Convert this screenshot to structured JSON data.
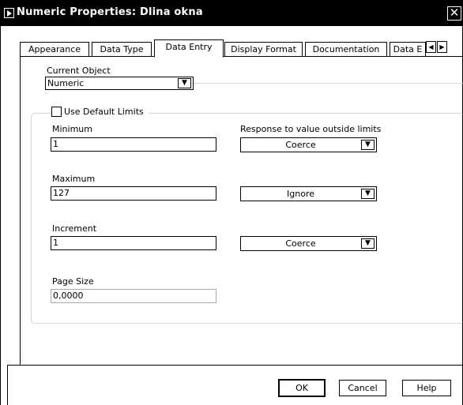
{
  "window": {
    "title": "Numeric Properties: Dlina okna"
  },
  "tabs": [
    {
      "label": "Appearance"
    },
    {
      "label": "Data Type"
    },
    {
      "label": "Data Entry",
      "active": true
    },
    {
      "label": "Display Format"
    },
    {
      "label": "Documentation"
    },
    {
      "label": "Data E"
    }
  ],
  "current_object": {
    "label": "Current Object",
    "value": "Numeric"
  },
  "use_default_limits": {
    "label": "Use Default Limits",
    "checked": false
  },
  "response_label": "Response to value outside limits",
  "minimum": {
    "label": "Minimum",
    "value": "1",
    "response": "Coerce"
  },
  "maximum": {
    "label": "Maximum",
    "value": "127",
    "response": "Ignore"
  },
  "increment": {
    "label": "Increment",
    "value": "1",
    "response": "Coerce"
  },
  "page_size": {
    "label": "Page Size",
    "value": "0,0000"
  },
  "buttons": {
    "ok": "OK",
    "cancel": "Cancel",
    "help": "Help"
  },
  "icons": {
    "dropdown": "chevron-down-icon",
    "close": "close-icon",
    "scroll_left": "arrow-left-icon",
    "scroll_right": "arrow-right-icon"
  }
}
